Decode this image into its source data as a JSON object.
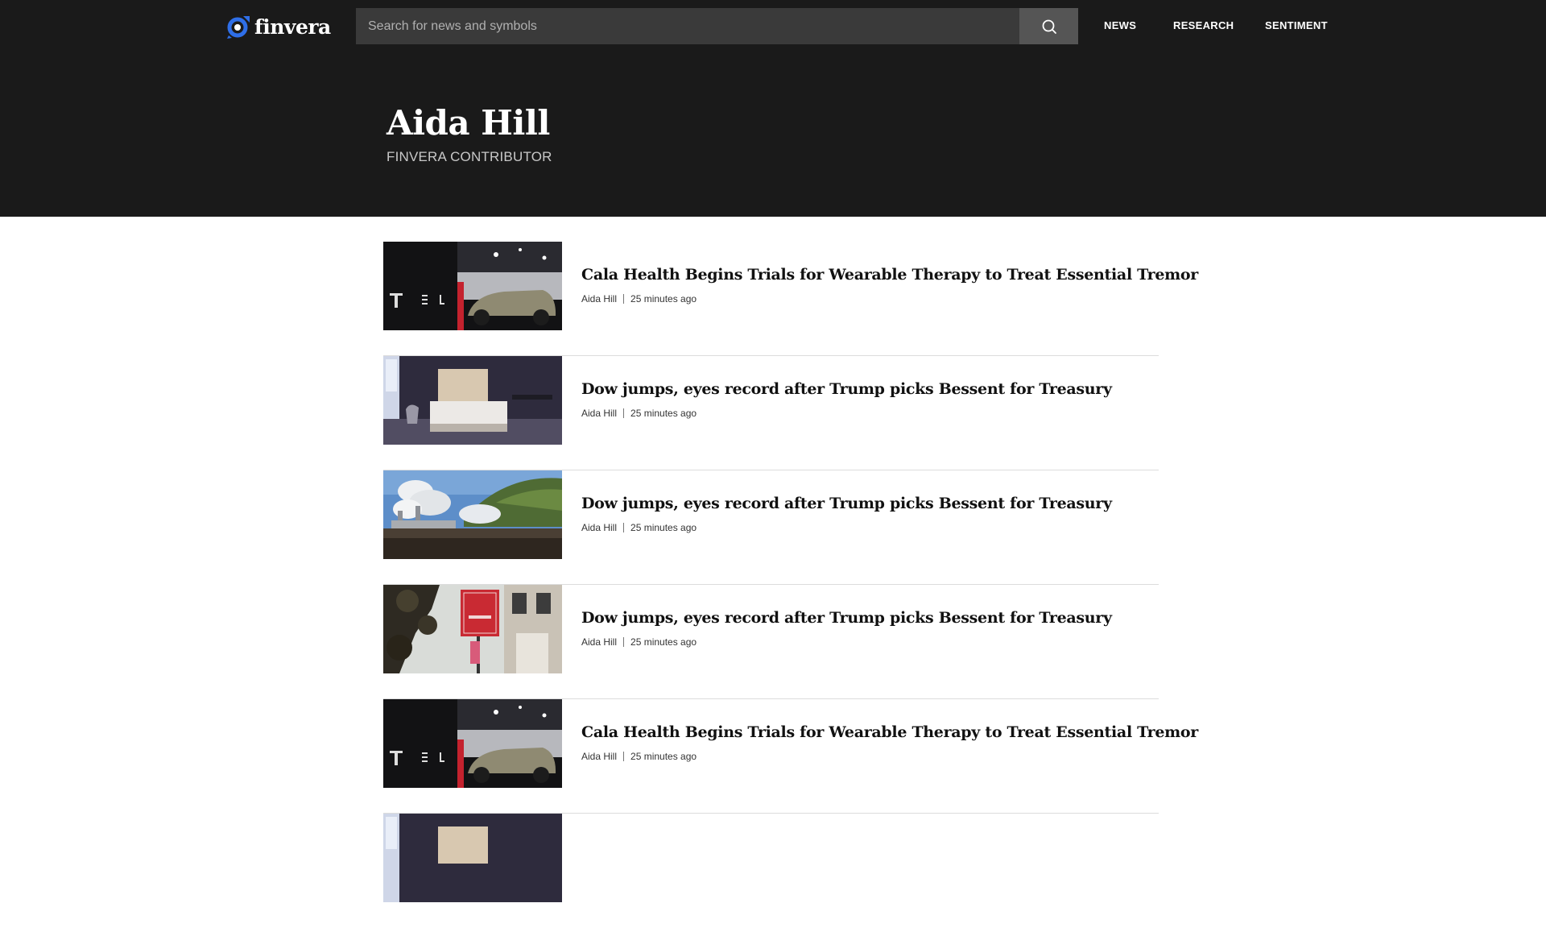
{
  "brand": {
    "name": "finvera",
    "accent": "#2f6fe8"
  },
  "search": {
    "placeholder": "Search for news and symbols",
    "icon": "search-icon"
  },
  "nav": [
    {
      "label": "NEWS"
    },
    {
      "label": "RESEARCH"
    },
    {
      "label": "SENTIMENT"
    }
  ],
  "author": {
    "name": "Aida Hill",
    "role": "FINVERA CONTRIBUTOR"
  },
  "articles": [
    {
      "title": "Cala Health Begins Trials for Wearable Therapy to Treat Essential Tremor",
      "author": "Aida Hill",
      "time": "25 minutes ago",
      "image": "car-showroom"
    },
    {
      "title": "Dow jumps, eyes record after Trump picks Bessent for Treasury",
      "author": "Aida Hill",
      "time": "25 minutes ago",
      "image": "bedroom"
    },
    {
      "title": "Dow jumps, eyes record after Trump picks Bessent for Treasury",
      "author": "Aida Hill",
      "time": "25 minutes ago",
      "image": "geothermal-plant"
    },
    {
      "title": "Dow jumps, eyes record after Trump picks Bessent for Treasury",
      "author": "Aida Hill",
      "time": "25 minutes ago",
      "image": "bank-sign"
    },
    {
      "title": "Cala Health Begins Trials for Wearable Therapy to Treat Essential Tremor",
      "author": "Aida Hill",
      "time": "25 minutes ago",
      "image": "car-showroom"
    },
    {
      "title": "",
      "author": "",
      "time": "",
      "image": "bedroom"
    }
  ]
}
